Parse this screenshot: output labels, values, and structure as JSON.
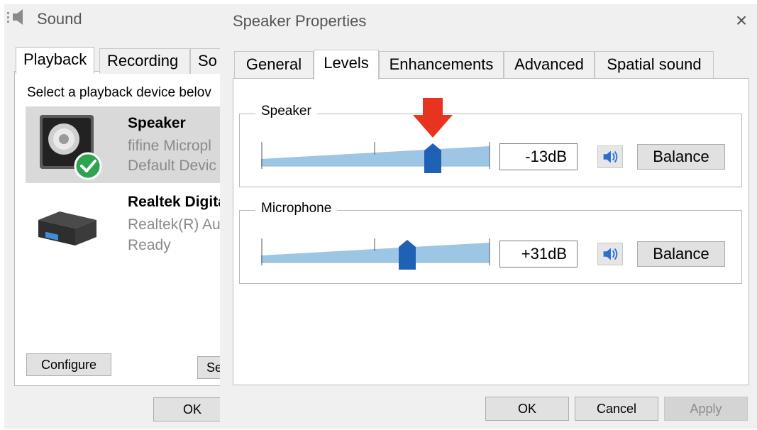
{
  "sound_window": {
    "title": "Sound",
    "tabs": [
      "Playback",
      "Recording",
      "So"
    ],
    "prompt": "Select a playback device belov",
    "devices": [
      {
        "name": "Speaker",
        "description": "fifine Micropl",
        "status": "Default Devic",
        "selected": true,
        "default": true
      },
      {
        "name": "Realtek Digita",
        "description": "Realtek(R) Au",
        "status": "Ready",
        "selected": false,
        "default": false
      }
    ],
    "buttons": {
      "configure": "Configure",
      "set": "Se",
      "ok": "OK"
    }
  },
  "properties": {
    "title": "Speaker Properties",
    "close_glyph": "×",
    "tabs": [
      "General",
      "Levels",
      "Enhancements",
      "Advanced",
      "Spatial sound"
    ],
    "active_tab": "Levels",
    "levels": [
      {
        "label": "Speaker",
        "value": "-13dB",
        "balance_label": "Balance",
        "slider_fraction": 0.72
      },
      {
        "label": "Microphone",
        "value": "+31dB",
        "balance_label": "Balance",
        "slider_fraction": 0.64
      }
    ],
    "buttons": {
      "ok": "OK",
      "cancel": "Cancel",
      "apply": "Apply"
    },
    "colors": {
      "slider_fill": "#9cc6e4",
      "thumb": "#1f62b5",
      "annotation_arrow": "#e8341f"
    }
  }
}
